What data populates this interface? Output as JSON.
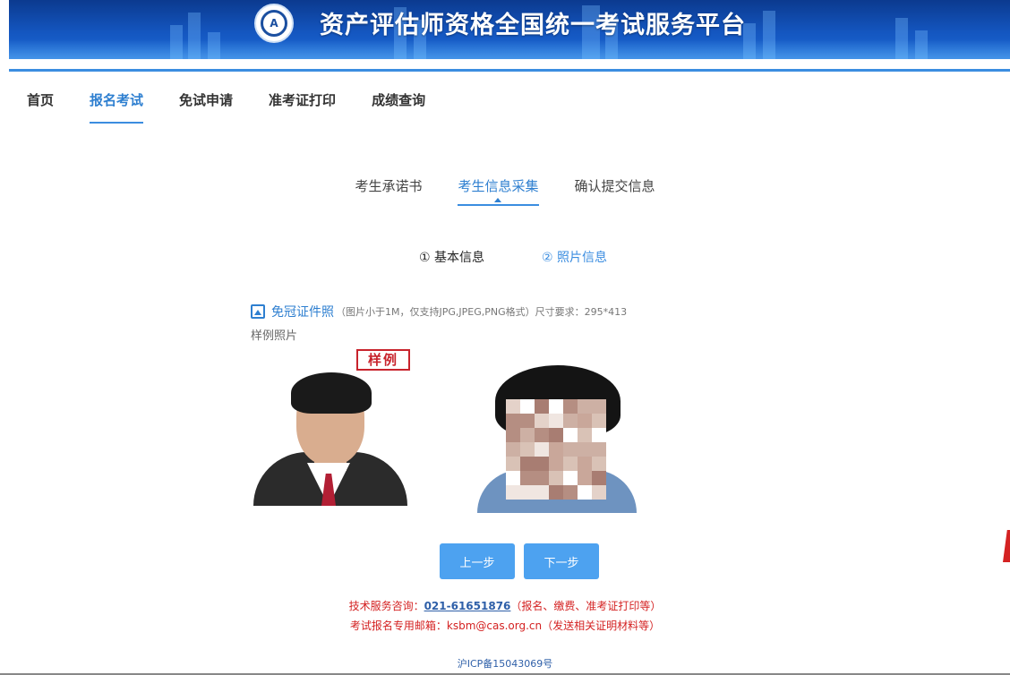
{
  "header": {
    "site_title": "资产评估师资格全国统一考试服务平台",
    "logo_icon": "cas-seal-icon",
    "logo_text": "A"
  },
  "nav": {
    "items": [
      {
        "label": "首页"
      },
      {
        "label": "报名考试"
      },
      {
        "label": "免试申请"
      },
      {
        "label": "准考证打印"
      },
      {
        "label": "成绩查询"
      }
    ],
    "active": "报名考试"
  },
  "steps": {
    "items": [
      {
        "label": "考生承诺书"
      },
      {
        "label": "考生信息采集"
      },
      {
        "label": "确认提交信息"
      }
    ],
    "active": "考生信息采集"
  },
  "sub_steps": {
    "items": [
      {
        "label": "① 基本信息"
      },
      {
        "label": "② 照片信息"
      }
    ]
  },
  "upload": {
    "icon": "image-icon",
    "title": "免冠证件照",
    "requirement": "（图片小于1M，仅支持JPG,JPEG,PNG格式）尺寸要求：295*413",
    "sample_label": "样例照片",
    "sample_badge": "样例"
  },
  "buttons": {
    "prev": "上一步",
    "next": "下一步"
  },
  "footer": {
    "tech_prefix": "技术服务咨询：",
    "tech_phone": "021-61651876",
    "tech_suffix": "（报名、缴费、准考证打印等）",
    "email_prefix": "考试报名专用邮箱：",
    "email": "ksbm@cas.org.cn",
    "email_suffix": "（发送相关证明材料等）",
    "icp": "沪ICP备15043069号"
  },
  "colors": {
    "accent": "#3b8de0",
    "button": "#4da2f0",
    "banner": "#1456c0",
    "warning_red": "#d42222"
  }
}
